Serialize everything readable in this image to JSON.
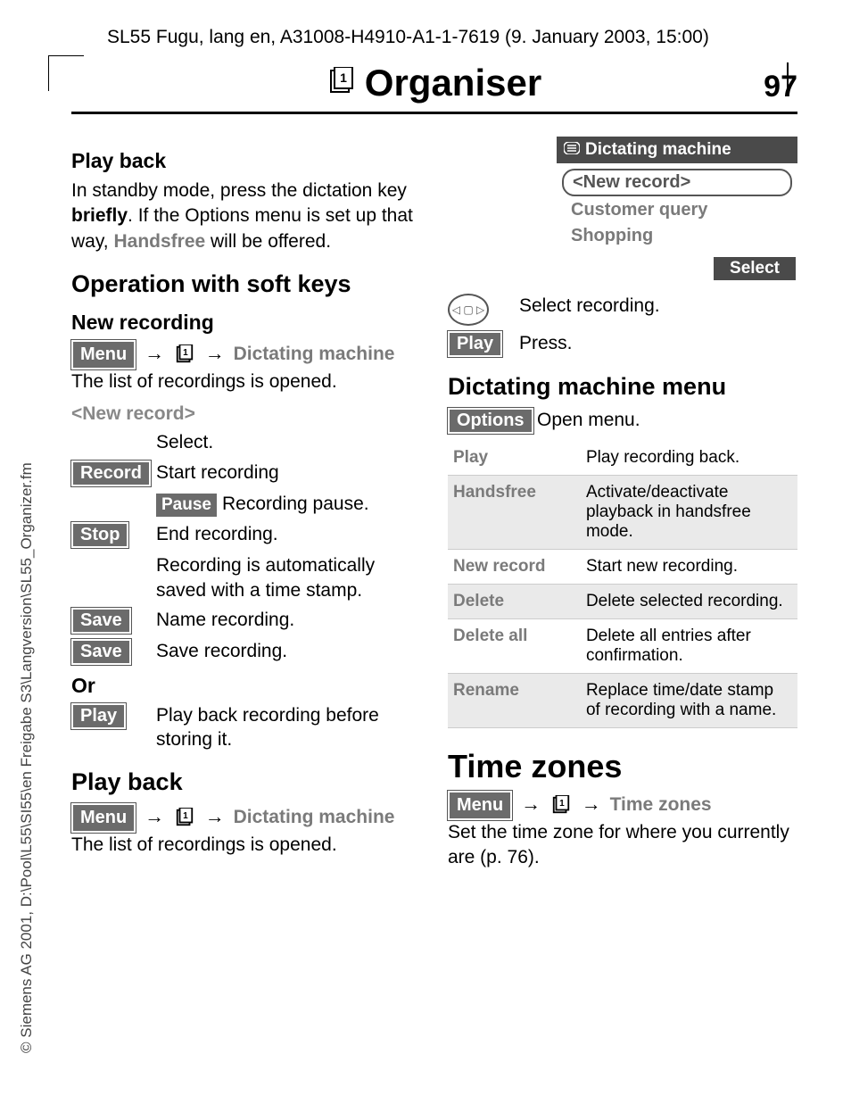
{
  "header": {
    "top_line": "SL55 Fugu, lang en, A31008-H4910-A1-1-7619 (9. January 2003, 15:00)",
    "title": "Organiser",
    "page_number": "97"
  },
  "copyright": "© Siemens AG 2001, D:\\Pool\\L55\\SI55\\en Freigabe S3\\Langversion\\SL55_Organizer.fm",
  "left": {
    "play_back_h": "Play back",
    "play_back_body_1": "In standby mode, press the dictation key ",
    "play_back_body_bold": "briefly",
    "play_back_body_2": ". If the Options menu is set up that way, ",
    "play_back_body_gray": "Handsfree",
    "play_back_body_3": " will be offered.",
    "op_soft_h": "Operation with soft keys",
    "new_rec_h": "New recording",
    "menu_key": "Menu",
    "dict_machine": "Dictating machine",
    "list_opened": "The list of recordings is opened.",
    "new_record_label": "<New record>",
    "select_text": "Select.",
    "record_key": "Record",
    "record_desc": "Start recording",
    "pause_key": "Pause",
    "pause_desc": "Recording pause.",
    "stop_key": "Stop",
    "stop_desc": "End recording.",
    "stop_desc2": "Recording is automatically saved with a time stamp.",
    "save1_key": "Save",
    "save1_desc": "Name recording.",
    "save2_key": "Save",
    "save2_desc": "Save recording.",
    "or_text": "Or",
    "play_key": "Play",
    "play_desc": "Play back recording before storing it.",
    "play_back_h2": "Play back",
    "list_opened2": "The list of recordings is opened."
  },
  "right": {
    "screen": {
      "title": "Dictating machine",
      "item1": "<New record>",
      "item2": "Customer query",
      "item3": "Shopping",
      "softkey": "Select"
    },
    "nav_desc": "Select recording.",
    "play_key": "Play",
    "press": "Press.",
    "dm_menu_h": "Dictating machine menu",
    "options_key": "Options",
    "open_menu": "Open menu.",
    "menu": [
      {
        "k": "Play",
        "v": "Play recording back."
      },
      {
        "k": "Handsfree",
        "v": "Activate/deactivate playback in handsfree mode."
      },
      {
        "k": "New record",
        "v": "Start new recording."
      },
      {
        "k": "Delete",
        "v": "Delete selected recording."
      },
      {
        "k": "Delete all",
        "v": "Delete all entries after confirmation."
      },
      {
        "k": "Rename",
        "v": "Replace time/date stamp of recording with a name."
      }
    ],
    "tz_h": "Time zones",
    "tz_menu_item": "Time zones",
    "tz_body": "Set the time zone for where you currently are (p. 76)."
  }
}
